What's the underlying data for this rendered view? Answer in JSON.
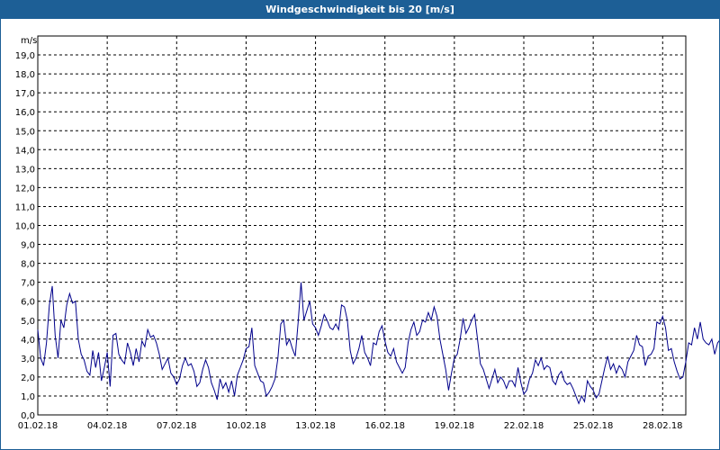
{
  "window": {
    "title": "Windgeschwindigkeit bis 20 [m/s]"
  },
  "chart_data": {
    "type": "line",
    "title": "Windgeschwindigkeit bis 20 [m/s]",
    "ylabel": "m/s",
    "xlabel": "",
    "ylim": [
      0,
      20
    ],
    "xlim": [
      "01.02.18",
      "01.03.18"
    ],
    "grid": true,
    "line_color": "#00008b",
    "yticks": [
      "0,0",
      "1,0",
      "2,0",
      "3,0",
      "4,0",
      "5,0",
      "6,0",
      "7,0",
      "8,0",
      "9,0",
      "10,0",
      "11,0",
      "12,0",
      "13,0",
      "14,0",
      "15,0",
      "16,0",
      "17,0",
      "18,0",
      "19,0"
    ],
    "xticks": [
      "01.02.18",
      "04.02.18",
      "07.02.18",
      "10.02.18",
      "13.02.18",
      "16.02.18",
      "19.02.18",
      "22.02.18",
      "25.02.18",
      "28.02.18"
    ],
    "series": [
      {
        "start": "01.02.18",
        "step_hours": 3,
        "values": [
          4.5,
          3.0,
          2.6,
          3.8,
          5.8,
          6.8,
          4.2,
          3.0,
          5.0,
          4.6,
          5.8,
          6.4,
          5.9,
          6.0,
          4.0,
          3.2,
          2.9,
          2.3,
          2.1,
          3.4,
          2.5,
          3.3,
          1.8,
          2.5,
          3.3,
          1.5,
          4.2,
          4.3,
          3.2,
          2.9,
          2.7,
          3.8,
          3.3,
          2.6,
          3.5,
          2.8,
          3.9,
          3.6,
          4.5,
          4.1,
          4.2,
          3.8,
          3.2,
          2.4,
          2.7,
          3.0,
          2.2,
          2.0,
          1.6,
          1.9,
          2.6,
          3.0,
          2.6,
          2.7,
          2.3,
          1.5,
          1.7,
          2.4,
          2.9,
          2.5,
          1.7,
          1.3,
          0.8,
          1.9,
          1.4,
          1.7,
          1.2,
          1.8,
          1.0,
          2.1,
          2.5,
          2.9,
          3.5,
          3.6,
          4.6,
          2.6,
          2.2,
          1.8,
          1.7,
          1.0,
          1.2,
          1.5,
          1.9,
          3.0,
          4.8,
          5.0,
          3.7,
          4.0,
          3.5,
          3.1,
          4.9,
          7.0,
          5.0,
          5.5,
          6.0,
          4.8,
          4.6,
          4.2,
          4.7,
          5.3,
          5.0,
          4.6,
          4.5,
          4.8,
          4.5,
          5.8,
          5.7,
          5.0,
          3.4,
          2.7,
          3.0,
          3.5,
          4.2,
          3.3,
          3.0,
          2.6,
          3.8,
          3.7,
          4.4,
          4.7,
          3.9,
          3.3,
          3.1,
          3.5,
          2.8,
          2.5,
          2.2,
          2.5,
          3.8,
          4.5,
          4.9,
          4.2,
          4.4,
          5.0,
          4.9,
          5.4,
          5.0,
          5.7,
          5.2,
          4.0,
          3.2,
          2.4,
          1.3,
          2.2,
          3.0,
          3.2,
          4.0,
          5.1,
          4.3,
          4.6,
          5.0,
          5.3,
          4.0,
          2.7,
          2.4,
          1.9,
          1.4,
          1.9,
          2.4,
          1.7,
          2.0,
          1.8,
          1.4,
          1.8,
          1.8,
          1.5,
          2.5,
          1.7,
          1.1,
          1.3,
          1.9,
          2.2,
          2.9,
          2.6,
          3.0,
          2.4,
          2.6,
          2.5,
          1.8,
          1.6,
          2.1,
          2.3,
          1.8,
          1.6,
          1.7,
          1.4,
          1.0,
          0.6,
          1.0,
          0.7,
          1.8,
          1.5,
          1.3,
          0.9,
          1.1,
          1.8,
          2.5,
          3.1,
          2.4,
          2.7,
          2.2,
          2.6,
          2.4,
          2.0,
          2.8,
          3.1,
          3.4,
          4.2,
          3.7,
          3.6,
          2.6,
          3.1,
          3.2,
          3.5,
          4.9,
          4.8,
          5.2,
          4.6,
          3.4,
          3.5,
          2.8,
          2.3,
          1.9,
          2.0,
          2.8,
          3.8,
          3.7,
          4.6,
          4.0,
          4.9,
          4.0,
          3.8,
          3.7,
          4.0,
          3.2,
          3.8,
          4.0,
          2.4,
          2.8,
          4.2,
          6.2,
          6.3,
          5.5,
          5.1,
          4.6,
          3.4,
          3.3,
          4.7,
          5.0,
          4.6,
          4.4,
          3.8,
          4.6,
          2.8,
          3.7,
          4.6,
          5.9,
          3.0,
          2.3,
          2.6,
          3.2,
          4.2,
          5.4,
          6.9,
          6.5,
          5.2,
          3.2,
          3.6,
          4.5,
          4.3,
          2.8,
          3.6,
          4.2,
          5.0,
          3.4,
          3.2,
          4.8,
          4.6,
          3.5,
          3.0,
          2.7,
          3.5,
          4.5,
          4.8,
          5.2,
          5.4,
          5.0,
          5.7,
          6.4,
          5.6
        ]
      }
    ]
  }
}
